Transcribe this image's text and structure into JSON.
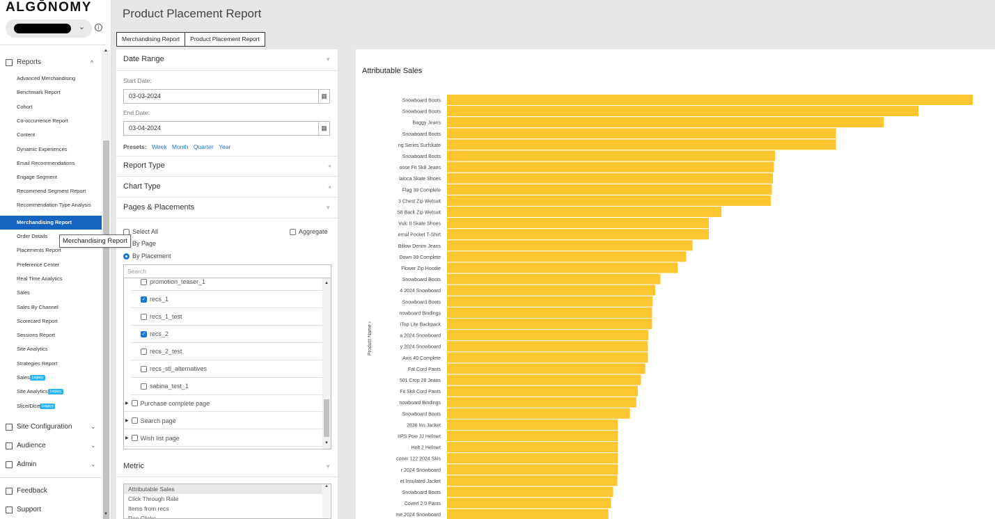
{
  "brand": {
    "logo": "ALGŌNOMY"
  },
  "page": {
    "title": "Product Placement Report"
  },
  "tabs": [
    "Merchandising Report",
    "Product Placement Report"
  ],
  "sidebar": {
    "reports_label": "Reports",
    "report_items": [
      "Advanced Merchandising",
      "Benchmark Report",
      "Cohort",
      "Co-occurrence Report",
      "Content",
      "Dynamic Experiences",
      "Email Recommendations",
      "Engage Segment",
      "Recommend Segment Report",
      "Recommendation Type Analysis",
      "Merchandising Report",
      "Order Details",
      "Placements Report",
      "Preference Center",
      "Real Time Analytics",
      "Sales",
      "Sales By Channel",
      "Scorecard Report",
      "Sessions Report",
      "Site Analytics",
      "Strategies Report",
      "Sales",
      "Site Analytics",
      "Slice/Dice"
    ],
    "legacy_badge": "Legacy",
    "site_configuration": "Site Configuration",
    "audience": "Audience",
    "admin": "Admin",
    "feedback": "Feedback",
    "support": "Support",
    "tooltip": "Merchandising Report"
  },
  "filters": {
    "date_range": "Date Range",
    "start_label": "Start Date:",
    "start_value": "03-03-2024",
    "end_label": "End Date:",
    "end_value": "03-04-2024",
    "presets_label": "Presets:",
    "presets": [
      "Week",
      "Month",
      "Quarter",
      "Year"
    ],
    "report_type": "Report Type",
    "chart_type": "Chart Type",
    "pages_placements": "Pages & Placements",
    "select_all": "Select All",
    "aggregate": "Aggregate",
    "by_page": "By Page",
    "by_placement": "By Placement",
    "search_placeholder": "Search",
    "placements": [
      {
        "name": "promotion_teaser_1",
        "checked": false
      },
      {
        "name": "recs_1",
        "checked": true
      },
      {
        "name": "recs_1_test",
        "checked": false
      },
      {
        "name": "recs_2",
        "checked": true
      },
      {
        "name": "recs_2_test",
        "checked": false
      },
      {
        "name": "recs_stl_alternatives",
        "checked": false
      },
      {
        "name": "sabina_test_1",
        "checked": false
      }
    ],
    "page_groups": [
      "Purchase complete page",
      "Search page",
      "Wish list page"
    ],
    "metric": "Metric",
    "metric_options": [
      "Attributable Sales",
      "Click Through Rate",
      "Items from recs",
      "Rec Clicks"
    ]
  },
  "chart_data": {
    "type": "bar",
    "orientation": "horizontal",
    "title": "Attributable Sales",
    "ylabel": "Product Name",
    "categories": [
      "Snowboard Boots",
      "Snowboard Boots",
      "Baggy Jeans",
      "Snowboard Boots",
      "ng Series Surfskate",
      "Snowboard Boots",
      "oose Fit Sk8 Jeans",
      "laioca Skate Shoes",
      "Flag 39 Complete",
      "3 Chest Zip Wetsuit",
      "S8 Back Zip Wetsuit",
      "Vulc II Skate Shoes",
      "ernal Pocket T-Shirt",
      "Billow Denim Jeans",
      "Down 39 Complete",
      "Flower Zip Hoodie",
      "Snowboard Boots",
      "4 2024 Snowboard",
      "Snowboard Boots",
      "nowboard Bindings",
      "ITop Lite Backpack",
      "a 2024 Snowboard",
      "y 2024 Snowboard",
      "Axis 40 Complete",
      "Fat Cord Pants",
      "501 Crop 28 Jeans",
      "Fit Sk8 Cord Pants",
      "nowboard Bindings",
      "Snowboard Boots",
      "2836 Ins Jacket",
      "IIPS Pow JJ Helmet",
      "Holt 2 Helmet",
      "coner 122 2024 Skis",
      "r 2024 Snowboard",
      "et Insulated Jacket",
      "Snowboard Boots",
      "Covert 2.0 Pants",
      "me 2024 Snowboard"
    ],
    "values": [
      100,
      89.7,
      83.1,
      74,
      74,
      62.4,
      62.2,
      62,
      61.8,
      61.6,
      52.2,
      49.8,
      49.8,
      46.7,
      45.5,
      43.9,
      40.6,
      39.6,
      39.1,
      39,
      39,
      38.3,
      38.2,
      38.2,
      37.7,
      36.9,
      36.3,
      36,
      34.8,
      32.5,
      32.5,
      32.5,
      32.5,
      32.5,
      32.4,
      31.6,
      31.2,
      30.7
    ],
    "xlim": [
      0,
      100
    ],
    "bar_color": "#fcc630"
  }
}
